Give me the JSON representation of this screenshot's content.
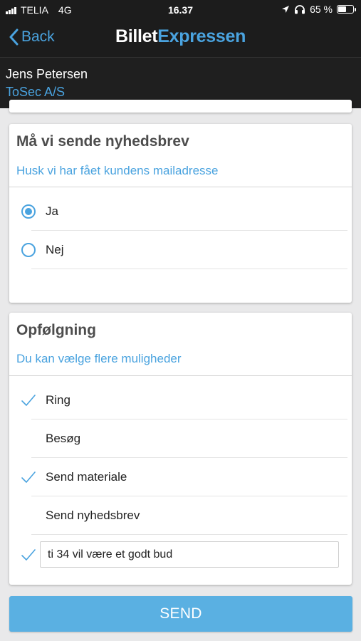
{
  "status_bar": {
    "carrier": "TELIA",
    "network": "4G",
    "time": "16.37",
    "battery_percent_label": "65 %",
    "battery_level": 0.65
  },
  "nav": {
    "back_label": "Back",
    "logo_part1": "Billet",
    "logo_part2": "Expressen"
  },
  "user": {
    "name": "Jens Petersen",
    "company": "ToSec A/S"
  },
  "newsletter_card": {
    "title": "Må vi sende nyhedsbrev",
    "subtitle": "Husk vi har fået kundens mailadresse",
    "options": [
      {
        "label": "Ja",
        "selected": true
      },
      {
        "label": "Nej",
        "selected": false
      }
    ]
  },
  "followup_card": {
    "title": "Opfølgning",
    "subtitle": "Du kan vælge flere muligheder",
    "options": [
      {
        "label": "Ring",
        "checked": true
      },
      {
        "label": "Besøg",
        "checked": false
      },
      {
        "label": "Send materiale",
        "checked": true
      },
      {
        "label": "Send nyhedsbrev",
        "checked": false
      }
    ],
    "note": {
      "value": "ti 34 vil være et godt bud",
      "checked": true
    }
  },
  "send_button_label": "SEND",
  "colors": {
    "accent": "#4aa3df",
    "button": "#5ab0e2",
    "header_bg": "#1c1c1c"
  }
}
